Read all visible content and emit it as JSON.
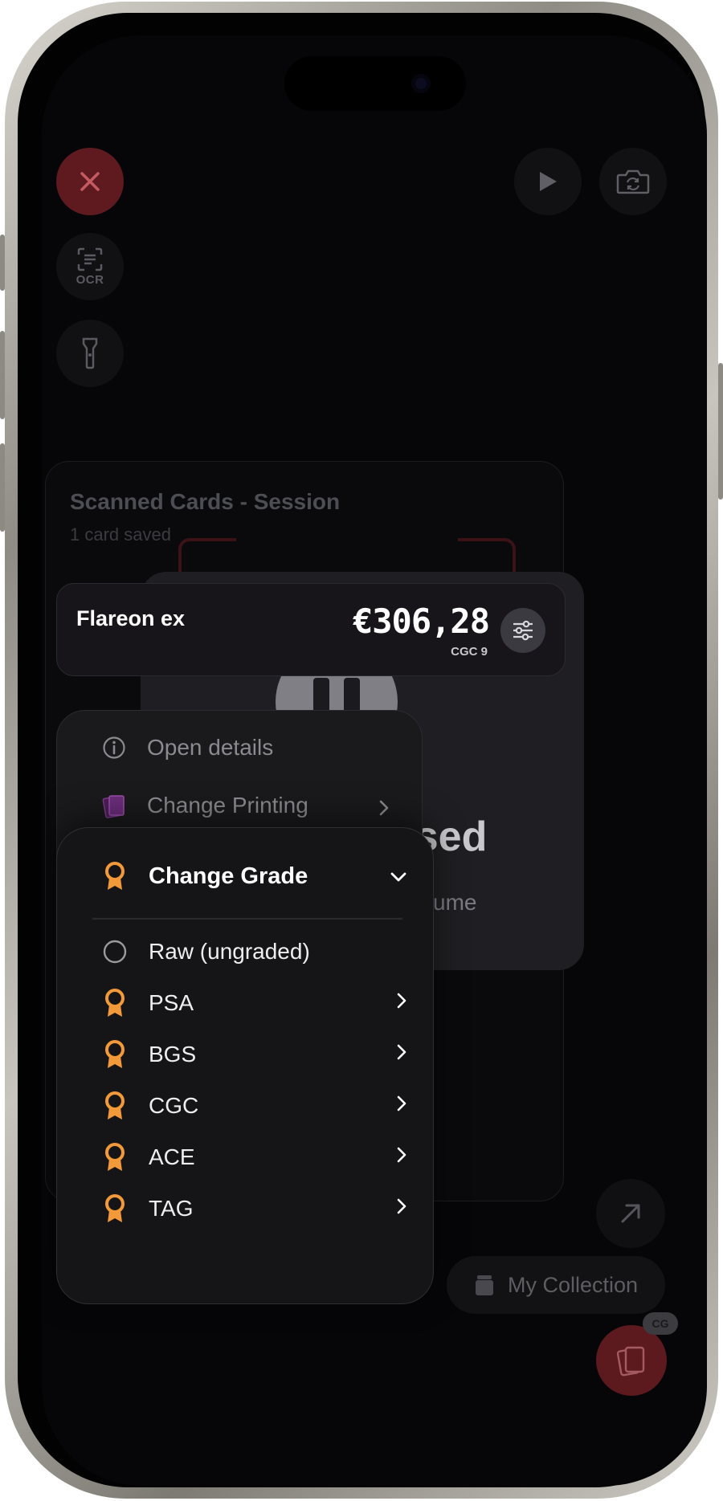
{
  "top_controls": {
    "ocr_label": "OCR"
  },
  "session": {
    "title": "Scanned Cards - Session",
    "subtitle": "1 card saved"
  },
  "paused": {
    "title": "used",
    "resume_text": "sume"
  },
  "card": {
    "name": "Flareon ex",
    "price": "€306,28",
    "grade": "CGC 9"
  },
  "context_menu": {
    "open_details": "Open details",
    "change_printing": "Change Printing"
  },
  "grade_menu": {
    "header": "Change Grade",
    "options": [
      {
        "label": "Raw (ungraded)",
        "icon": "radio-circle-icon"
      },
      {
        "label": "PSA",
        "icon": "award-ribbon-icon"
      },
      {
        "label": "BGS",
        "icon": "award-ribbon-icon"
      },
      {
        "label": "CGC",
        "icon": "award-ribbon-icon"
      },
      {
        "label": "ACE",
        "icon": "award-ribbon-icon"
      },
      {
        "label": "TAG",
        "icon": "award-ribbon-icon"
      }
    ]
  },
  "bottom": {
    "collection_label": "My Collection",
    "fab_badge": "CG"
  },
  "colors": {
    "accent_orange": "#f2993a",
    "close_red": "#5e1a1f",
    "menu_bg": "#151517"
  }
}
